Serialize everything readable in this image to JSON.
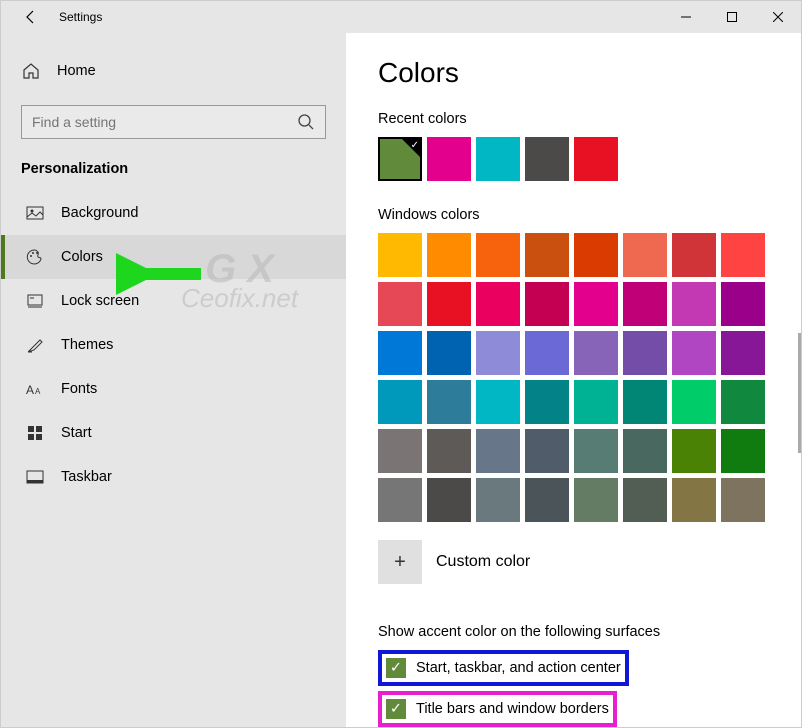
{
  "window": {
    "title": "Settings"
  },
  "sidebar": {
    "home_label": "Home",
    "search_placeholder": "Find a setting",
    "section_title": "Personalization",
    "items": [
      {
        "label": "Background",
        "icon": "image"
      },
      {
        "label": "Colors",
        "icon": "palette",
        "selected": true
      },
      {
        "label": "Lock screen",
        "icon": "lock-grid"
      },
      {
        "label": "Themes",
        "icon": "paintbrush"
      },
      {
        "label": "Fonts",
        "icon": "font"
      },
      {
        "label": "Start",
        "icon": "start"
      },
      {
        "label": "Taskbar",
        "icon": "taskbar"
      }
    ]
  },
  "main": {
    "heading": "Colors",
    "recent_label": "Recent colors",
    "recent_colors": [
      "#618a3a",
      "#e3008c",
      "#00b7c3",
      "#4c4a48",
      "#e81123"
    ],
    "recent_selected_index": 0,
    "windows_colors_label": "Windows colors",
    "windows_colors": [
      "#ffb900",
      "#ff8c00",
      "#f7630c",
      "#ca5010",
      "#da3b01",
      "#ef6950",
      "#d13438",
      "#ff4343",
      "#e74856",
      "#e81123",
      "#ea005e",
      "#c30052",
      "#e3008c",
      "#bf0077",
      "#c239b3",
      "#9a0089",
      "#0078d7",
      "#0063b1",
      "#8e8cd8",
      "#6b69d6",
      "#8764b8",
      "#744da9",
      "#b146c2",
      "#881798",
      "#0099bc",
      "#2d7d9a",
      "#00b7c3",
      "#038387",
      "#00b294",
      "#018574",
      "#00cc6a",
      "#10893e",
      "#7a7574",
      "#5d5a58",
      "#68768a",
      "#515c6b",
      "#567c73",
      "#486860",
      "#498205",
      "#107c10",
      "#767676",
      "#4c4a48",
      "#69797e",
      "#4a5459",
      "#647c64",
      "#525e54",
      "#847545",
      "#7e735f"
    ],
    "custom_color_label": "Custom color",
    "surfaces_heading": "Show accent color on the following surfaces",
    "surface_options": [
      {
        "label": "Start, taskbar, and action center",
        "checked": true
      },
      {
        "label": "Title bars and window borders",
        "checked": true
      }
    ]
  },
  "annotation": {
    "arrow_color": "#1fd61f",
    "watermark_text_top": "G X",
    "watermark_text_bottom": "Ceofix.net"
  }
}
